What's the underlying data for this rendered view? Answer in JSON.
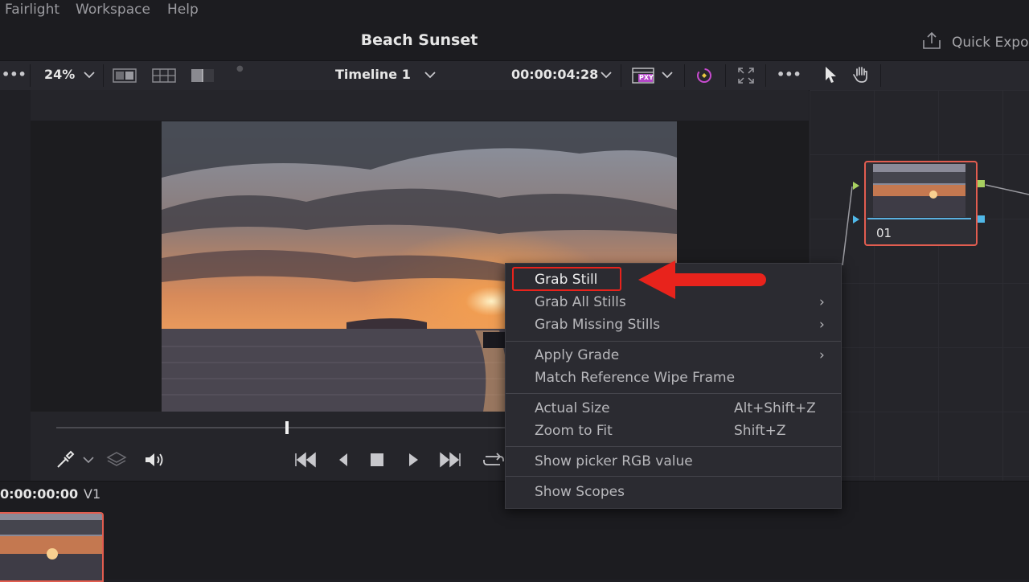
{
  "menubar": {
    "items": [
      "Fairlight",
      "Workspace",
      "Help"
    ]
  },
  "titlebar": {
    "project_title": "Beach Sunset",
    "quick_export": "Quick Expor"
  },
  "toolbar": {
    "more": "•••",
    "zoom": "24%",
    "timeline_name": "Timeline 1",
    "timecode": "00:00:04:28",
    "proxy_badge": "PXY",
    "more_right": "•••"
  },
  "node": {
    "label": "01"
  },
  "timeline": {
    "timecode": "0:00:00:00",
    "track": "V1"
  },
  "context_menu": {
    "items": [
      {
        "label": "Grab Still"
      },
      {
        "label": "Grab All Stills",
        "submenu": "›"
      },
      {
        "label": "Grab Missing Stills",
        "submenu": "›"
      },
      {
        "label": "Apply Grade",
        "submenu": "›"
      },
      {
        "label": "Match Reference Wipe Frame"
      },
      {
        "label": "Actual Size",
        "shortcut": "Alt+Shift+Z"
      },
      {
        "label": "Zoom to Fit",
        "shortcut": "Shift+Z"
      },
      {
        "label": "Show picker RGB value"
      },
      {
        "label": "Show Scopes"
      }
    ]
  },
  "colors": {
    "accent_red": "#e8231c",
    "node_border": "#e25d50",
    "bg": "#1f1f24"
  },
  "icons": [
    "dots-icon",
    "chevron-down-icon",
    "single-viewer-icon",
    "grid-viewer-icon",
    "wipe-icon",
    "proxy-icon",
    "magic-icon",
    "fullscreen-icon",
    "pointer-icon",
    "hand-icon",
    "export-icon",
    "eyedropper-icon",
    "layers-icon",
    "speaker-icon",
    "skip-back-icon",
    "step-back-icon",
    "stop-icon",
    "play-icon",
    "skip-forward-icon",
    "loop-icon",
    "arrow-annotation-icon"
  ]
}
